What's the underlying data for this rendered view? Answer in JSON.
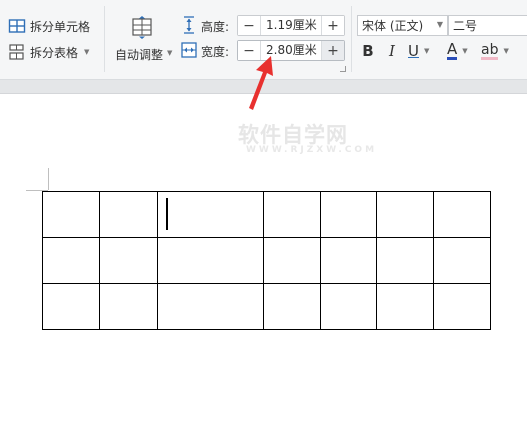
{
  "ribbon": {
    "split_cells_label": "拆分单元格",
    "split_table_label": "拆分表格",
    "auto_adjust_label": "自动调整",
    "height_label": "高度:",
    "height_value": "1.19厘米",
    "width_label": "宽度:",
    "width_value": "2.80厘米",
    "minus_symbol": "−",
    "plus_symbol": "+",
    "font_name": "宋体 (正文)",
    "font_size": "二号",
    "bold_label": "B",
    "italic_label": "I",
    "underline_label": "U",
    "font_color_label": "A",
    "highlight_label": "ab"
  },
  "document": {
    "watermark": "软件自学网",
    "watermark_sub": "WWW.RJZXW.COM",
    "table": {
      "rows": 3,
      "columns": 7
    }
  },
  "annotation": {
    "arrow_color": "#e8312f"
  }
}
